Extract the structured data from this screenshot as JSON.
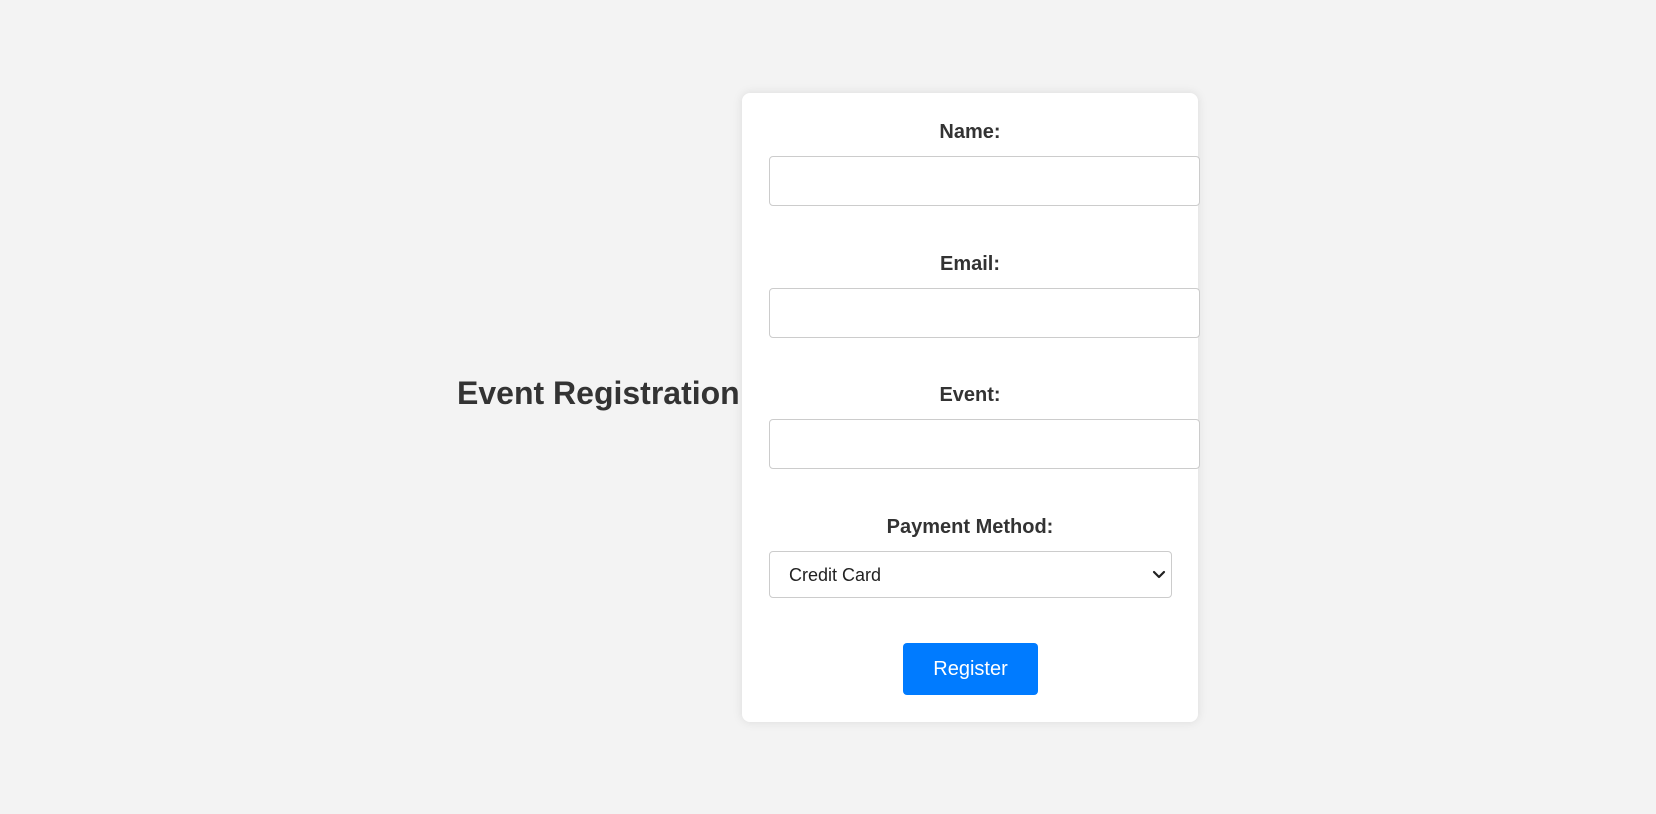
{
  "page": {
    "title": "Event Registration"
  },
  "form": {
    "fields": [
      {
        "label": "Name:",
        "value": "",
        "placeholder": ""
      },
      {
        "label": "Email:",
        "value": "",
        "placeholder": ""
      },
      {
        "label": "Event:",
        "value": "",
        "placeholder": ""
      }
    ],
    "payment": {
      "label": "Payment Method:",
      "selected": "Credit Card"
    },
    "submit_label": "Register"
  },
  "colors": {
    "background": "#f3f3f3",
    "card": "#ffffff",
    "text": "#333333",
    "accent": "#007bff",
    "button_text": "#ffffff"
  },
  "icons": {
    "select_arrow": "chevron-down-icon"
  }
}
